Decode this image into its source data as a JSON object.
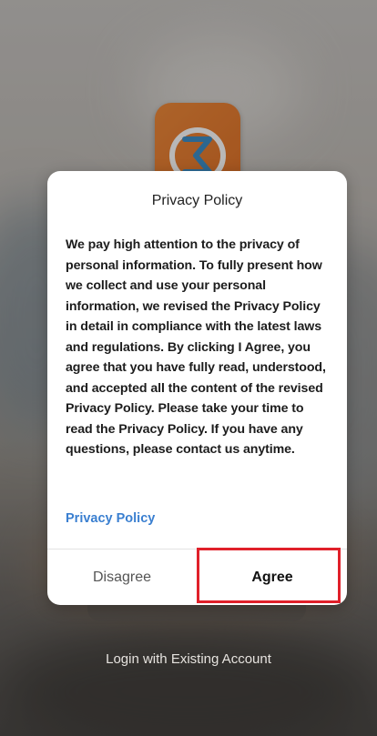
{
  "background": {
    "login_link": "Login with Existing Account"
  },
  "logo": {
    "icon": "sigma-logo-icon",
    "color": "#e2742a"
  },
  "dialog": {
    "title": "Privacy Policy",
    "body": "We pay high attention to the privacy of personal information. To fully present how we collect and use your personal information, we revised the Privacy Policy in detail in compliance with the latest laws and regulations. By clicking I Agree, you agree that you have fully read, understood, and accepted all the content of the revised Privacy Policy. Please take your time to read the Privacy Policy. If you have any questions, please contact us anytime.",
    "policy_link": "Privacy Policy",
    "disagree_label": "Disagree",
    "agree_label": "Agree",
    "link_color": "#3a7fd0",
    "highlight_color": "#e0202a"
  }
}
